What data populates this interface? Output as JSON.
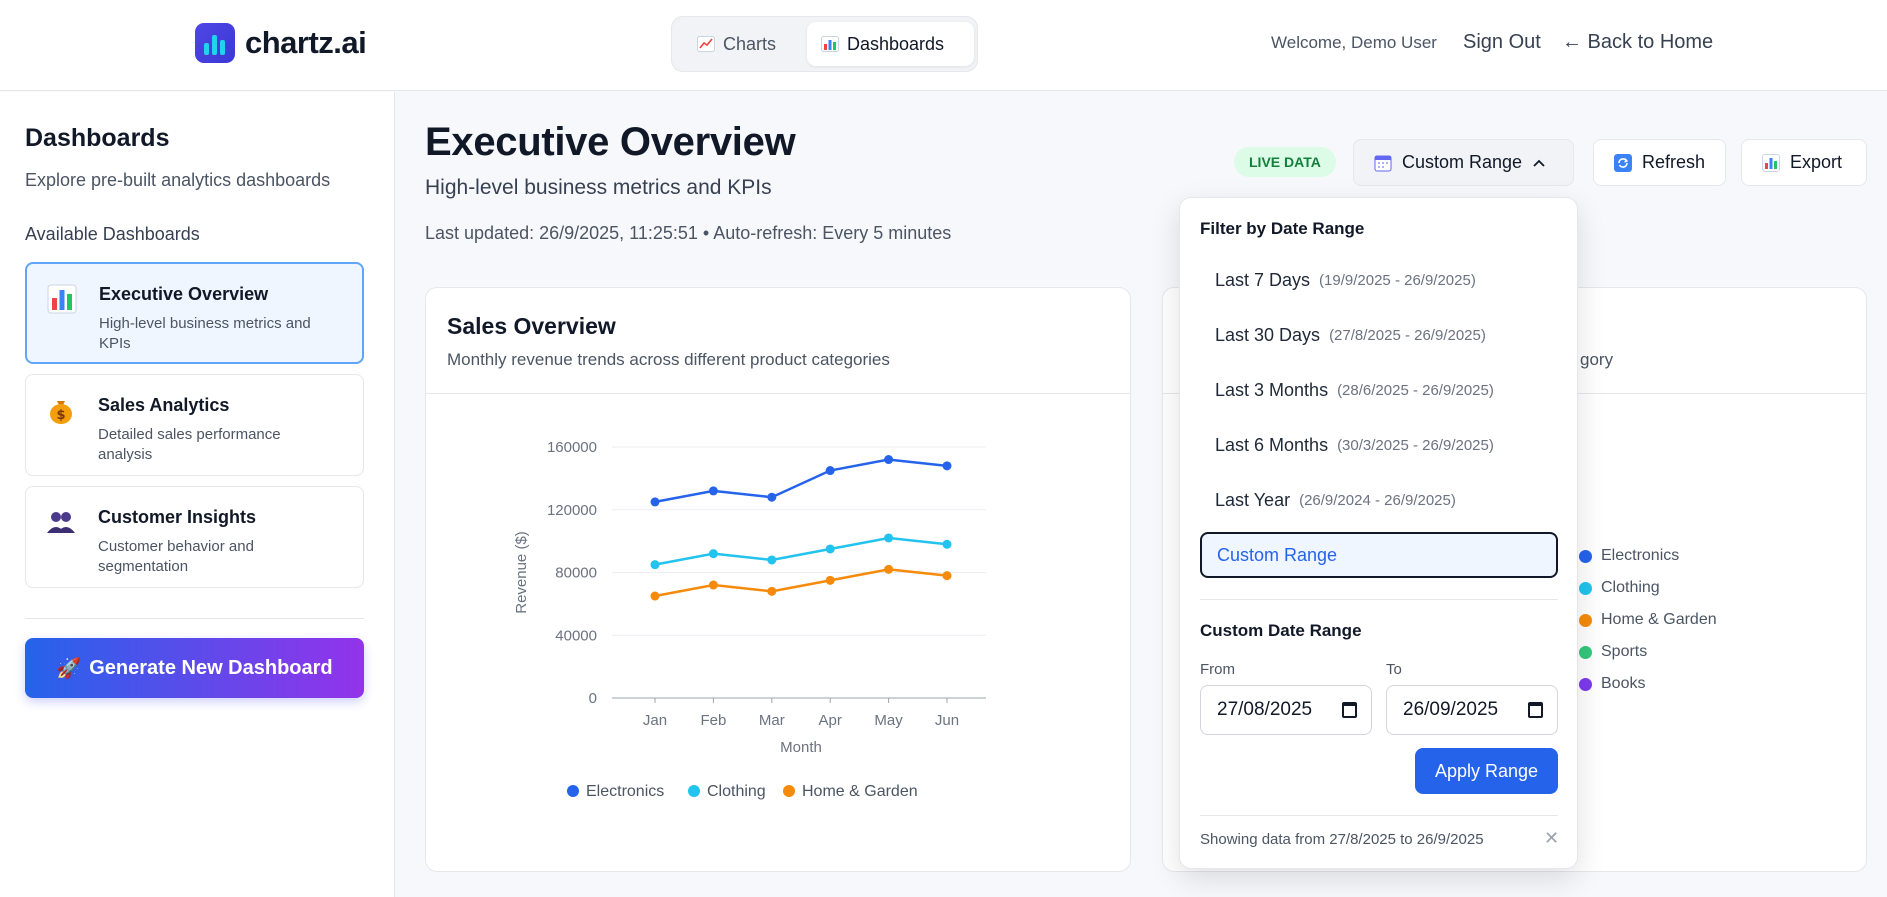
{
  "brand": {
    "name": "chartz.ai"
  },
  "nav": {
    "tabs": [
      {
        "label": "Charts",
        "icon": "line-chart-icon"
      },
      {
        "label": "Dashboards",
        "icon": "bar-chart-icon",
        "active": true
      }
    ]
  },
  "user": {
    "welcome": "Welcome, Demo User",
    "sign_out": "Sign Out",
    "back_home": "← Back to Home"
  },
  "sidebar": {
    "title": "Dashboards",
    "subtitle": "Explore pre-built analytics dashboards",
    "section_label": "Available Dashboards",
    "items": [
      {
        "name": "Executive Overview",
        "desc": "High-level business metrics and KPIs",
        "icon": "bar-chart-icon",
        "active": true
      },
      {
        "name": "Sales Analytics",
        "desc": "Detailed sales performance analysis",
        "icon": "money-bag-icon"
      },
      {
        "name": "Customer Insights",
        "desc": "Customer behavior and segmentation",
        "icon": "users-icon"
      }
    ],
    "generate_label": "Generate New Dashboard"
  },
  "header": {
    "title": "Executive Overview",
    "subtitle": "High-level business metrics and KPIs",
    "updated": "Last updated: 26/9/2025, 11:25:51 • Auto-refresh: Every 5 minutes",
    "live_badge": "LIVE DATA",
    "range_button": "Custom Range",
    "refresh_button": "Refresh",
    "export_button": "Export"
  },
  "card_left": {
    "title": "Sales Overview",
    "subtitle": "Monthly revenue trends across different product categories"
  },
  "card_right": {
    "subtitle_partial": "gory"
  },
  "right_legend": [
    "Electronics",
    "Clothing",
    "Home & Garden",
    "Sports",
    "Books"
  ],
  "right_legend_colors": [
    "#2563eb",
    "#22c3ee",
    "#f58a0b",
    "#34c77b",
    "#7c3aed"
  ],
  "dropdown": {
    "heading": "Filter by Date Range",
    "options": [
      {
        "label": "Last 7 Days",
        "dates": "(19/9/2025 - 26/9/2025)"
      },
      {
        "label": "Last 30 Days",
        "dates": "(27/8/2025 - 26/9/2025)"
      },
      {
        "label": "Last 3 Months",
        "dates": "(28/6/2025 - 26/9/2025)"
      },
      {
        "label": "Last 6 Months",
        "dates": "(30/3/2025 - 26/9/2025)"
      },
      {
        "label": "Last Year",
        "dates": "(26/9/2024 - 26/9/2025)"
      },
      {
        "label": "Custom Range",
        "dates": "",
        "selected": true
      }
    ],
    "custom_heading": "Custom Date Range",
    "from_label": "From",
    "to_label": "To",
    "from_value": "27/08/2025",
    "to_value": "26/09/2025",
    "apply_label": "Apply Range",
    "footer": "Showing data from 27/8/2025 to 26/9/2025",
    "close": "✕"
  },
  "chart_data": {
    "type": "line",
    "categories": [
      "Jan",
      "Feb",
      "Mar",
      "Apr",
      "May",
      "Jun"
    ],
    "series": [
      {
        "name": "Electronics",
        "color": "#2563eb",
        "values": [
          125000,
          132000,
          128000,
          145000,
          152000,
          148000
        ]
      },
      {
        "name": "Clothing",
        "color": "#22c3ee",
        "values": [
          85000,
          92000,
          88000,
          95000,
          102000,
          98000
        ]
      },
      {
        "name": "Home & Garden",
        "color": "#f58a0b",
        "values": [
          65000,
          72000,
          68000,
          75000,
          82000,
          78000
        ]
      }
    ],
    "xlabel": "Month",
    "ylabel": "Revenue ($)",
    "ylim": [
      0,
      160000
    ],
    "yticks": [
      "0",
      "40000",
      "80000",
      "120000",
      "160000"
    ],
    "grid": true,
    "legend": "bottom"
  }
}
